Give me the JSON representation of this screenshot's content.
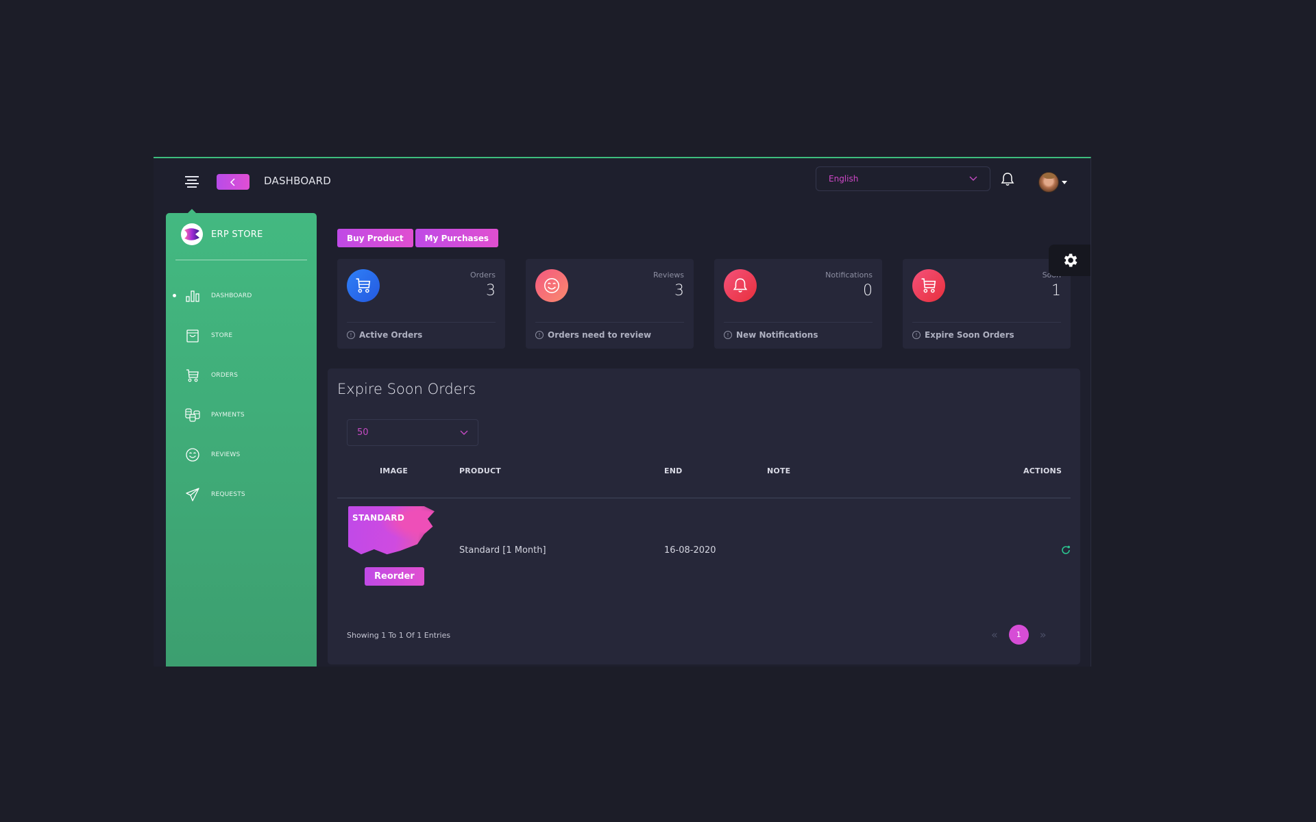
{
  "header": {
    "page_title": "DASHBOARD",
    "language": {
      "selected": "English"
    }
  },
  "sidebar": {
    "brand": "ERP STORE",
    "items": [
      {
        "label": "DASHBOARD",
        "icon": "bar-chart-icon",
        "active": true
      },
      {
        "label": "STORE",
        "icon": "shopping-bag-icon",
        "active": false
      },
      {
        "label": "ORDERS",
        "icon": "cart-icon",
        "active": false
      },
      {
        "label": "PAYMENTS",
        "icon": "coins-icon",
        "active": false
      },
      {
        "label": "REVIEWS",
        "icon": "smile-icon",
        "active": false
      },
      {
        "label": "REQUESTS",
        "icon": "paper-plane-icon",
        "active": false
      }
    ]
  },
  "actions": {
    "buy_product": "Buy Product",
    "my_purchases": "My Purchases"
  },
  "stats": [
    {
      "label": "Orders",
      "value": "3",
      "footer": "Active Orders",
      "icon": "cart-icon",
      "color": "#2d6cf0"
    },
    {
      "label": "Reviews",
      "value": "3",
      "footer": "Orders need to review",
      "icon": "smile-icon",
      "color": "#f56a7e"
    },
    {
      "label": "Notifications",
      "value": "0",
      "footer": "New Notifications",
      "icon": "bell-icon",
      "color": "#ef3a4e"
    },
    {
      "label": "Soon",
      "value": "1",
      "footer": "Expire Soon Orders",
      "icon": "cart-icon",
      "color": "#ef3a4e"
    }
  ],
  "table": {
    "title": "Expire Soon Orders",
    "page_length": "50",
    "columns": [
      "IMAGE",
      "PRODUCT",
      "END",
      "NOTE",
      "ACTIONS"
    ],
    "rows": [
      {
        "image_badge": "STANDARD",
        "reorder_label": "Reorder",
        "product": "Standard [1 Month]",
        "end": "16-08-2020",
        "note": ""
      }
    ],
    "info": "Showing 1 To 1 Of 1 Entries",
    "pagination": {
      "current": "1",
      "prev": "«",
      "next": "»"
    }
  },
  "colors": {
    "accent_green": "#3dbd7d",
    "accent_magenta": "#d64dd6",
    "background": "#1c1d28",
    "card": "#262739"
  }
}
